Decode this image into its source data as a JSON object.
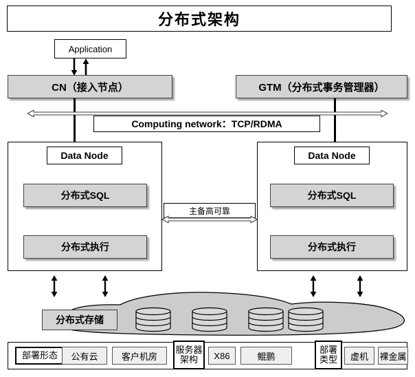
{
  "diagram": {
    "title": "分布式架构",
    "application": {
      "label": "Application"
    },
    "cn": {
      "label": "CN（接入节点）"
    },
    "gtm": {
      "label": "GTM（分布式事务管理器）"
    },
    "network": {
      "label": "Computing network：TCP/RDMA"
    },
    "ha_link": {
      "label": "主备高可靠"
    },
    "data_nodes": [
      {
        "title": "Data Node",
        "components": [
          {
            "label": "分布式SQL"
          },
          {
            "label": "分布式执行"
          }
        ]
      },
      {
        "title": "Data Node",
        "components": [
          {
            "label": "分布式SQL"
          },
          {
            "label": "分布式执行"
          }
        ]
      }
    ],
    "storage": {
      "label": "分布式存储",
      "disk_count": 4
    },
    "footer": {
      "groups": [
        {
          "key": "部署形态",
          "key_lines": [
            "部署形态"
          ],
          "options": [
            "公有云",
            "客户机房"
          ]
        },
        {
          "key": "服务器架构",
          "key_lines": [
            "服务器",
            "架构"
          ],
          "options": [
            "X86",
            "鲲鹏"
          ]
        },
        {
          "key": "部署类型",
          "key_lines": [
            "部署",
            "类型"
          ],
          "options": [
            "虚机",
            "裸金属"
          ]
        }
      ]
    },
    "colors": {
      "node_fill": "#d4d4d4",
      "cloud_fill": "#cccccc",
      "line": "#000000",
      "chip_fill": "#efefef"
    }
  }
}
